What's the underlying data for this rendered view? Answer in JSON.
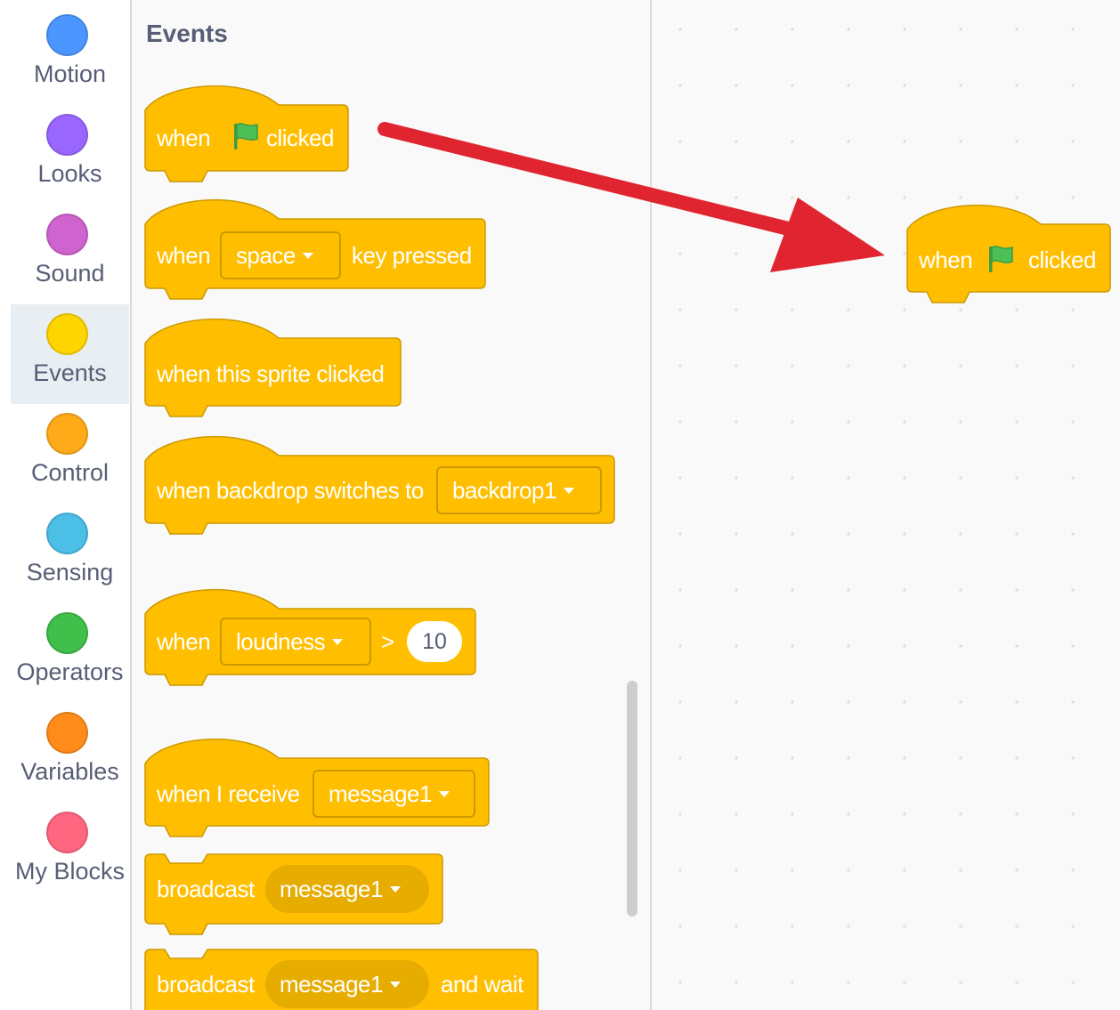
{
  "categories": [
    {
      "label": "Motion",
      "color": "#4c97ff"
    },
    {
      "label": "Looks",
      "color": "#9966ff"
    },
    {
      "label": "Sound",
      "color": "#cf63cf"
    },
    {
      "label": "Events",
      "color": "#ffd500",
      "selected": true
    },
    {
      "label": "Control",
      "color": "#ffab19"
    },
    {
      "label": "Sensing",
      "color": "#4cbfe6"
    },
    {
      "label": "Operators",
      "color": "#40bf4a"
    },
    {
      "label": "Variables",
      "color": "#ff8c1a"
    },
    {
      "label": "My Blocks",
      "color": "#ff6680"
    }
  ],
  "palette": {
    "title": "Events",
    "blocks": {
      "flag_clicked": {
        "when": "when",
        "clicked": "clicked",
        "icon": "green-flag-icon"
      },
      "key_pressed": {
        "when": "when",
        "key": "space",
        "suffix": "key pressed"
      },
      "sprite_clicked": {
        "text": "when this sprite clicked"
      },
      "backdrop": {
        "text": "when backdrop switches to",
        "backdrop": "backdrop1"
      },
      "loudness": {
        "when": "when",
        "sensor": "loudness",
        "op": ">",
        "value": "10"
      },
      "receive": {
        "text": "when I receive",
        "message": "message1"
      },
      "broadcast": {
        "text": "broadcast",
        "message": "message1"
      },
      "broadcast_wait": {
        "text": "broadcast",
        "message": "message1",
        "suffix": "and wait"
      }
    }
  },
  "workspace": {
    "block": {
      "when": "when",
      "clicked": "clicked",
      "icon": "green-flag-icon"
    }
  },
  "colors": {
    "event_block": "#ffbf00",
    "event_block_border": "#cc9900",
    "arrow": "#e02530",
    "flag": "#4cbf56"
  }
}
